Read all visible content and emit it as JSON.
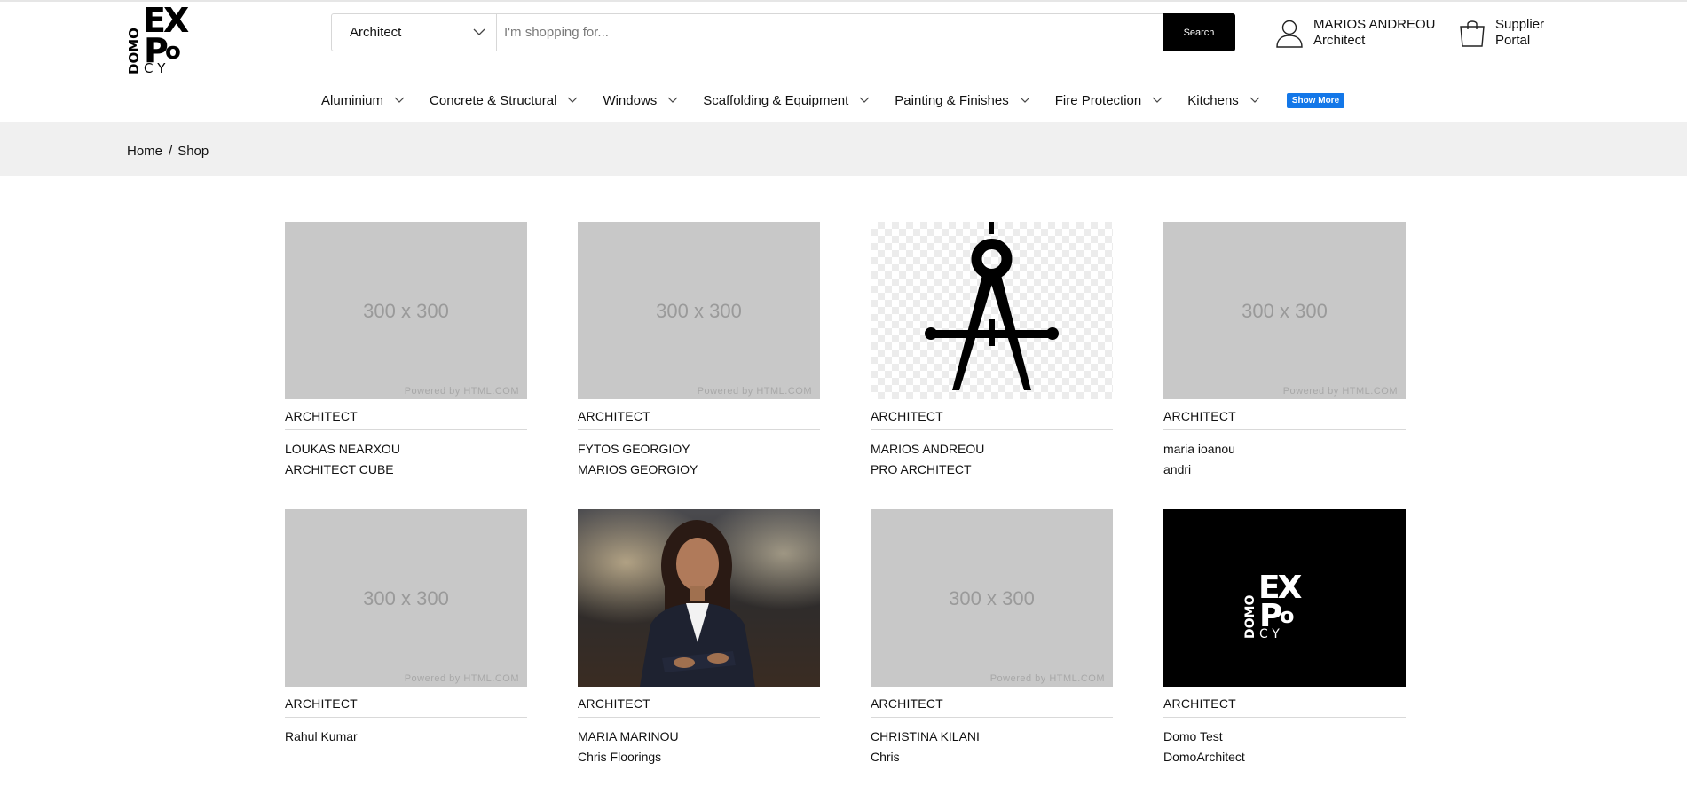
{
  "brand": {
    "logo_text": "DOMO EXPO CY"
  },
  "search": {
    "category": "Architect",
    "placeholder": "I'm shopping for...",
    "button_label": "Search"
  },
  "account": {
    "name": "MARIOS ANDREOU",
    "role": "Architect"
  },
  "supplier": {
    "line1": "Supplier",
    "line2": "Portal"
  },
  "nav": {
    "items": [
      {
        "label": "Aluminium"
      },
      {
        "label": "Concrete & Structural"
      },
      {
        "label": "Windows"
      },
      {
        "label": "Scaffolding & Equipment"
      },
      {
        "label": "Painting & Finishes"
      },
      {
        "label": "Fire Protection"
      },
      {
        "label": "Kitchens"
      }
    ],
    "show_more": "Show More"
  },
  "breadcrumb": {
    "home": "Home",
    "separator": "/",
    "current": "Shop"
  },
  "placeholder": {
    "dimensions": "300 x 300",
    "powered": "Powered by HTML.COM"
  },
  "products": [
    {
      "category": "ARCHITECT",
      "line1": "LOUKAS NEARXOU",
      "line2": "ARCHITECT CUBE",
      "image": "placeholder"
    },
    {
      "category": "ARCHITECT",
      "line1": "FYTOS GEORGIOY",
      "line2": "MARIOS GEORGIOY",
      "image": "placeholder"
    },
    {
      "category": "ARCHITECT",
      "line1": "MARIOS ANDREOU",
      "line2": "PRO ARCHITECT",
      "image": "compass-icon"
    },
    {
      "category": "ARCHITECT",
      "line1": "maria ioanou",
      "line2": "andri",
      "image": "placeholder"
    },
    {
      "category": "ARCHITECT",
      "line1": "Rahul Kumar",
      "line2": "",
      "image": "placeholder"
    },
    {
      "category": "ARCHITECT",
      "line1": "MARIA MARINOU",
      "line2": "Chris Floorings",
      "image": "portrait-photo"
    },
    {
      "category": "ARCHITECT",
      "line1": "CHRISTINA KILANI",
      "line2": "Chris",
      "image": "placeholder"
    },
    {
      "category": "ARCHITECT",
      "line1": "Domo Test",
      "line2": "DomoArchitect",
      "image": "domo-logo"
    }
  ],
  "colors": {
    "accent": "#1377e8",
    "search_button": "#000000",
    "breadcrumb_bg": "#f0f0f0",
    "placeholder_bg": "#c8c8c8"
  }
}
